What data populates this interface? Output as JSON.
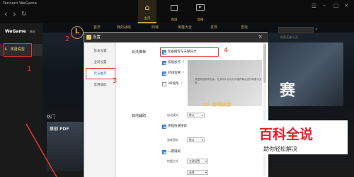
{
  "app": {
    "title": "Tencent WeGame"
  },
  "top_nav": {
    "tabs": [
      {
        "label": "主页",
        "icon": "home-icon",
        "active": true
      },
      {
        "label": "商城",
        "icon": "store-icon",
        "active": false
      },
      {
        "label": "直播",
        "icon": "live-icon",
        "active": false
      }
    ]
  },
  "sidebar": {
    "header": "WeGame",
    "header_badge": "精选",
    "items": [
      {
        "label": "英雄联盟",
        "icon": "lol-icon",
        "active": true
      }
    ]
  },
  "game_nav": {
    "items": [
      "首页",
      "我的战绩",
      "商城",
      "英雄大全",
      "发现",
      "查找"
    ],
    "search_placeholder": "搜索英雄/玩家"
  },
  "banner": {
    "text": "赛"
  },
  "hot_section": {
    "title": "热门"
  },
  "promo_card": {
    "text": "原创 PDF"
  },
  "dialog": {
    "title": "设置",
    "close": "×",
    "nav": [
      "基本设置",
      "全局设置",
      "玩法推荐",
      "常用辅助"
    ],
    "active_nav": 2,
    "section1_label": "玩法推荐：",
    "options": [
      {
        "label": "装备推荐与天赋符文",
        "checked": true
      },
      {
        "label": "技能加点",
        "checked": true
      },
      {
        "label": "对线攻略",
        "checked": true
      },
      {
        "label": "3D视角",
        "checked": false
      }
    ],
    "preview_hint": "根据英雄推荐出装，在游戏中自动为你推荐最合适的装备与天赋",
    "section2_label": "其他辅助：",
    "launch_mode_label": "启动模式",
    "launch_mode_value": "默认",
    "quick_search_label": "英雄快速搜索",
    "quick_search_checked": true,
    "game_mouse_label": "游戏鼠标",
    "game_mouse_value": "默认",
    "one_click_label": "一键辅助",
    "one_click_checked": true,
    "shortcut_label": "快捷方式",
    "shortcut_value": "左键设置",
    "extra_value": "选择"
  },
  "annotations": {
    "n1": "1",
    "n2": "2",
    "n3": "3",
    "n4": "4",
    "author_tag": "ID: 剑鸣侠客"
  },
  "watermark": {
    "brand": "百科全说",
    "sub": "助你轻松解决"
  },
  "colors": {
    "accent_gold": "#c8a050",
    "annotation_red": "#e53935",
    "check_blue": "#4a90e2"
  }
}
